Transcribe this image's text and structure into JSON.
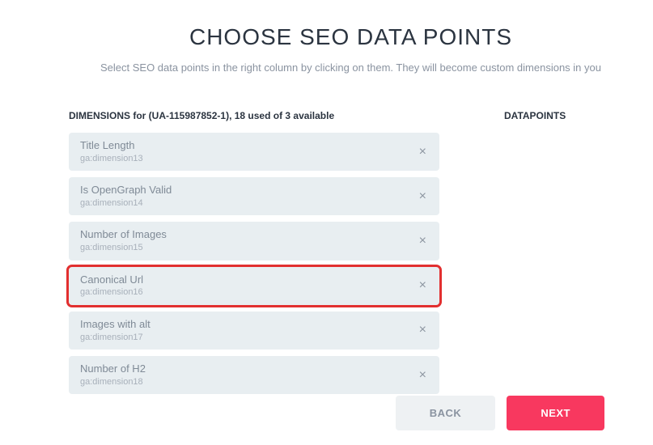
{
  "title": "CHOOSE SEO DATA POINTS",
  "subtitle": "Select SEO data points in the right column by clicking on them. They will become custom dimensions in you",
  "left": {
    "header": "DIMENSIONS for (UA-115987852-1), 18 used of 3 available",
    "items": [
      {
        "label": "Title Length",
        "key": "ga:dimension13",
        "highlighted": false
      },
      {
        "label": "Is OpenGraph Valid",
        "key": "ga:dimension14",
        "highlighted": false
      },
      {
        "label": "Number of Images",
        "key": "ga:dimension15",
        "highlighted": false
      },
      {
        "label": "Canonical Url",
        "key": "ga:dimension16",
        "highlighted": true
      },
      {
        "label": "Images with alt",
        "key": "ga:dimension17",
        "highlighted": false
      },
      {
        "label": "Number of H2",
        "key": "ga:dimension18",
        "highlighted": false
      }
    ]
  },
  "right": {
    "header": "DATAPOINTS"
  },
  "buttons": {
    "back": "BACK",
    "next": "NEXT"
  },
  "close_glyph": "×"
}
